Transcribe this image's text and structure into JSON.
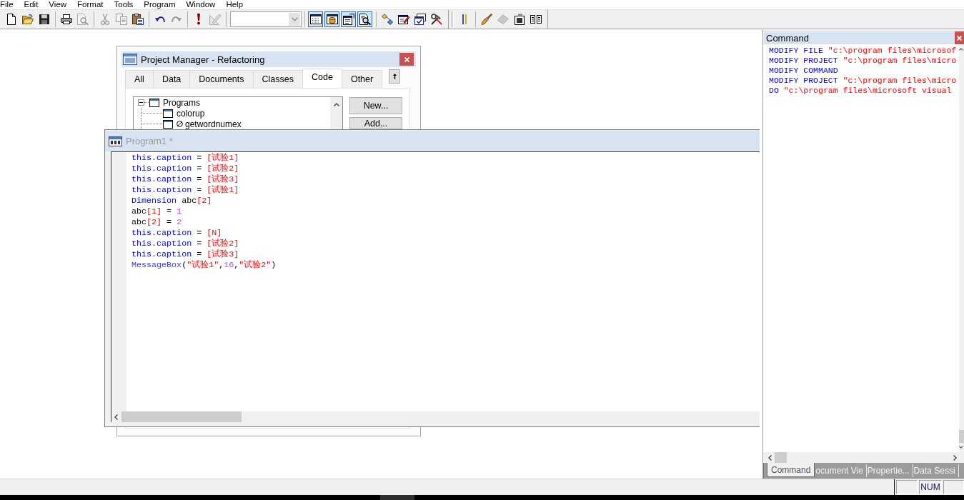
{
  "menu": [
    "File",
    "Edit",
    "View",
    "Format",
    "Tools",
    "Program",
    "Window",
    "Help"
  ],
  "toolbars": [
    {
      "groups": [
        [
          {
            "kind": "button",
            "disabled": false,
            "pressed": false
          },
          {
            "kind": "button",
            "disabled": false,
            "pressed": false
          },
          {
            "kind": "button",
            "disabled": false,
            "pressed": false
          }
        ],
        [
          {
            "kind": "button",
            "disabled": false,
            "pressed": false
          },
          {
            "kind": "button",
            "disabled": true,
            "pressed": false
          }
        ],
        [
          {
            "kind": "button",
            "disabled": true,
            "pressed": false
          },
          {
            "kind": "button",
            "disabled": true,
            "pressed": false
          },
          {
            "kind": "button",
            "disabled": false,
            "pressed": false
          }
        ],
        [
          {
            "kind": "button",
            "disabled": false,
            "pressed": false
          },
          {
            "kind": "button",
            "disabled": true,
            "pressed": false
          }
        ],
        [
          {
            "kind": "button",
            "disabled": false,
            "pressed": false
          },
          {
            "kind": "button",
            "disabled": true,
            "pressed": false
          }
        ],
        [
          {
            "kind": "combo",
            "disabled": true
          }
        ],
        [
          {
            "kind": "button",
            "disabled": false,
            "pressed": true
          },
          {
            "kind": "button",
            "disabled": false,
            "pressed": true
          },
          {
            "kind": "button",
            "disabled": false,
            "pressed": true
          },
          {
            "kind": "button",
            "disabled": false,
            "pressed": true
          }
        ],
        [
          {
            "kind": "button",
            "disabled": false,
            "pressed": false
          },
          {
            "kind": "button",
            "disabled": false,
            "pressed": false
          },
          {
            "kind": "button",
            "disabled": false,
            "pressed": false
          },
          {
            "kind": "button",
            "disabled": false,
            "pressed": false
          }
        ]
      ]
    },
    {
      "groups": [
        [
          {
            "kind": "button",
            "disabled": false,
            "pressed": false
          }
        ],
        [
          {
            "kind": "button",
            "disabled": false,
            "pressed": false
          },
          {
            "kind": "button",
            "disabled": true,
            "pressed": false
          },
          {
            "kind": "button",
            "disabled": false,
            "pressed": false
          },
          {
            "kind": "button",
            "disabled": false,
            "pressed": false
          }
        ]
      ]
    }
  ],
  "project_manager": {
    "title": "Project Manager - Refactoring",
    "active": true,
    "tabs": [
      {
        "label": "All",
        "selected": false
      },
      {
        "label": "Data",
        "selected": false
      },
      {
        "label": "Documents",
        "selected": false
      },
      {
        "label": "Classes",
        "selected": false
      },
      {
        "label": "Code",
        "selected": true
      },
      {
        "label": "Other",
        "selected": false
      }
    ],
    "tree": [
      {
        "label": "Programs",
        "expanded": true,
        "excluded": false,
        "children": [
          {
            "label": "colorup",
            "excluded": false
          },
          {
            "label": "getwordnumex",
            "excluded": true
          }
        ]
      }
    ],
    "buttons": [
      "New...",
      "Add..."
    ]
  },
  "program_window": {
    "title": "Program1 *",
    "active": false,
    "lines": [
      {
        "tokens": [
          {
            "kind": "keyword",
            "text": "this.caption"
          },
          {
            "kind": "text",
            "text": " = "
          },
          {
            "kind": "string",
            "text": "[试验1]"
          }
        ]
      },
      {
        "tokens": [
          {
            "kind": "keyword",
            "text": "this.caption"
          },
          {
            "kind": "text",
            "text": " = "
          },
          {
            "kind": "string",
            "text": "[试验2]"
          }
        ]
      },
      {
        "tokens": [
          {
            "kind": "keyword",
            "text": "this.caption"
          },
          {
            "kind": "text",
            "text": " = "
          },
          {
            "kind": "string",
            "text": "[试验3]"
          }
        ]
      },
      {
        "tokens": [
          {
            "kind": "keyword",
            "text": "this.caption"
          },
          {
            "kind": "text",
            "text": " = "
          },
          {
            "kind": "string",
            "text": "[试验1]"
          }
        ]
      },
      {
        "tokens": [
          {
            "kind": "keyword",
            "text": "Dimension"
          },
          {
            "kind": "text",
            "text": " abc"
          },
          {
            "kind": "string",
            "text": "[2]"
          }
        ]
      },
      {
        "tokens": [
          {
            "kind": "text",
            "text": "abc"
          },
          {
            "kind": "string",
            "text": "[1]"
          },
          {
            "kind": "text",
            "text": " = "
          },
          {
            "kind": "number",
            "text": "1"
          }
        ]
      },
      {
        "tokens": [
          {
            "kind": "text",
            "text": "abc"
          },
          {
            "kind": "string",
            "text": "[2]"
          },
          {
            "kind": "text",
            "text": " = "
          },
          {
            "kind": "number",
            "text": "2"
          }
        ]
      },
      {
        "tokens": [
          {
            "kind": "keyword",
            "text": "this.caption"
          },
          {
            "kind": "text",
            "text": " = "
          },
          {
            "kind": "string",
            "text": "[N]"
          }
        ]
      },
      {
        "tokens": [
          {
            "kind": "keyword",
            "text": "this.caption"
          },
          {
            "kind": "text",
            "text": " = "
          },
          {
            "kind": "string",
            "text": "[试验2]"
          }
        ]
      },
      {
        "tokens": [
          {
            "kind": "keyword",
            "text": "this.caption"
          },
          {
            "kind": "text",
            "text": " = "
          },
          {
            "kind": "string",
            "text": "[试验3]"
          }
        ]
      },
      {
        "tokens": [
          {
            "kind": "function",
            "text": "MessageBox"
          },
          {
            "kind": "text",
            "text": "("
          },
          {
            "kind": "string",
            "text": "\"试验1\""
          },
          {
            "kind": "text",
            "text": ","
          },
          {
            "kind": "number",
            "text": "16"
          },
          {
            "kind": "text",
            "text": ","
          },
          {
            "kind": "string",
            "text": "\"试验2\""
          },
          {
            "kind": "text",
            "text": ")"
          }
        ]
      }
    ]
  },
  "command_window": {
    "title": "Command",
    "lines": [
      {
        "tokens": [
          {
            "kind": "keyword",
            "text": "MODIFY FILE"
          },
          {
            "kind": "string",
            "text": " \"c:\\program files\\microsof"
          }
        ]
      },
      {
        "tokens": [
          {
            "kind": "keyword",
            "text": "MODIFY PROJECT"
          },
          {
            "kind": "string",
            "text": " \"c:\\program files\\micro"
          }
        ]
      },
      {
        "tokens": [
          {
            "kind": "keyword",
            "text": "MODIFY COMMAND"
          }
        ]
      },
      {
        "tokens": [
          {
            "kind": "keyword",
            "text": "MODIFY PROJECT"
          },
          {
            "kind": "string",
            "text": " \"c:\\program files\\micro"
          }
        ]
      },
      {
        "tokens": [
          {
            "kind": "keyword",
            "text": "DO"
          },
          {
            "kind": "string",
            "text": " \"c:\\program files\\microsoft visual"
          }
        ]
      }
    ],
    "tabs": [
      {
        "label": "Command",
        "selected": true
      },
      {
        "label": "ocument Vie",
        "selected": false
      },
      {
        "label": "Propertie...",
        "selected": false
      },
      {
        "label": "Data Sessi",
        "selected": false
      }
    ]
  },
  "status_bar": {
    "indicator": "NUM"
  }
}
